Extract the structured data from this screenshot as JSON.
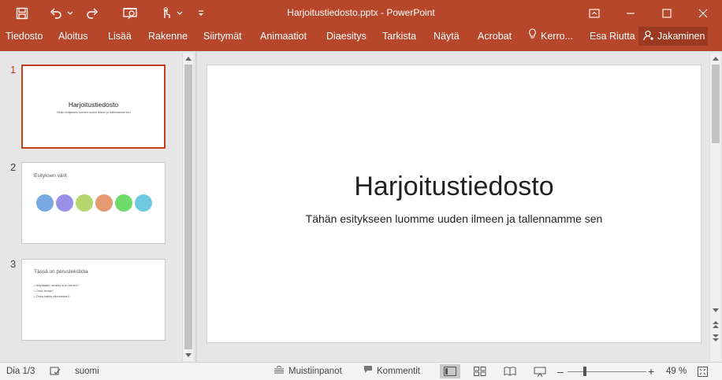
{
  "window": {
    "title": "Harjoitustiedosto.pptx - PowerPoint",
    "brand_color": "#b7472a"
  },
  "qat": {
    "icons": [
      "save-icon",
      "undo-icon",
      "redo-icon",
      "start-slideshow-icon",
      "touch-mode-icon",
      "customize-qat-icon"
    ]
  },
  "ribbon": {
    "tabs": [
      "Tiedosto",
      "Aloitus",
      "Lisää",
      "Rakenne",
      "Siirtymät",
      "Animaatiot",
      "Diaesitys",
      "Tarkista",
      "Näytä",
      "Acrobat"
    ],
    "tell_me": "Kerro...",
    "user": "Esa Riutta",
    "share": "Jakaminen"
  },
  "thumbnails": [
    {
      "number": "1",
      "title": "Harjoitustiedosto",
      "subtitle": "Tähän esitykseen luomme uuden ilmeen ja tallennamme sen"
    },
    {
      "number": "2",
      "title": "Esityksen värit",
      "circle_colors": [
        "#78a9e0",
        "#9b90e8",
        "#b5d66e",
        "#e59a73",
        "#6fdc6a",
        "#6ec8e0"
      ]
    },
    {
      "number": "3",
      "title": "Tässä on perustekstidia",
      "bullets": [
        "• Näyttääkö ranskis kuin ennen?",
        "• Onko kivaa?",
        "• Onko kaikki oikeestaan?"
      ]
    }
  ],
  "slide": {
    "title": "Harjoitustiedosto",
    "subtitle": "Tähän esitykseen luomme uuden ilmeen ja tallennamme sen"
  },
  "status": {
    "slide_counter": "Dia 1/3",
    "language": "suomi",
    "notes": "Muistiinpanot",
    "comments": "Kommentit",
    "zoom_percent": "49 %",
    "zoom_level": 0.49
  }
}
